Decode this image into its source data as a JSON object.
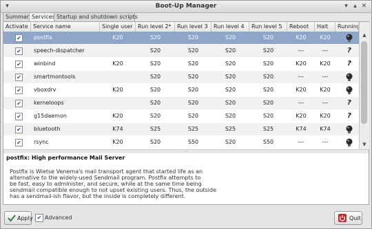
{
  "window": {
    "title": "Boot-Up Manager"
  },
  "tabs": [
    "Summary",
    "Services",
    "Startup and shutdown scripts"
  ],
  "columns": [
    "Activate",
    "Service name",
    "Single user",
    "Run level 2*",
    "Run level 3",
    "Run level 4",
    "Run level 5",
    "Reboot",
    "Halt",
    "Running"
  ],
  "rows": [
    {
      "name": "postfix",
      "single": "K20",
      "rl2": "S20",
      "rl3": "S20",
      "rl4": "S20",
      "rl5": "S20",
      "reboot": "K20",
      "halt": "K20",
      "running": "bulb",
      "selected": true
    },
    {
      "name": "speech-dispatcher",
      "single": "",
      "rl2": "S20",
      "rl3": "S20",
      "rl4": "S20",
      "rl5": "S20",
      "reboot": "---",
      "halt": "---",
      "running": "?"
    },
    {
      "name": "winbind",
      "single": "K20",
      "rl2": "S20",
      "rl3": "S20",
      "rl4": "S20",
      "rl5": "S20",
      "reboot": "K20",
      "halt": "K20",
      "running": "?"
    },
    {
      "name": "smartmontools",
      "single": "",
      "rl2": "S20",
      "rl3": "S20",
      "rl4": "S20",
      "rl5": "S20",
      "reboot": "---",
      "halt": "---",
      "running": "bulb"
    },
    {
      "name": "vboxdrv",
      "single": "K20",
      "rl2": "S20",
      "rl3": "S20",
      "rl4": "S20",
      "rl5": "S20",
      "reboot": "K20",
      "halt": "K20",
      "running": "bulb"
    },
    {
      "name": "kerneloops",
      "single": "",
      "rl2": "S20",
      "rl3": "S20",
      "rl4": "S20",
      "rl5": "S20",
      "reboot": "---",
      "halt": "---",
      "running": "?"
    },
    {
      "name": "g15daemon",
      "single": "K20",
      "rl2": "S20",
      "rl3": "S20",
      "rl4": "S20",
      "rl5": "S20",
      "reboot": "K20",
      "halt": "K20",
      "running": "?"
    },
    {
      "name": "bluetooth",
      "single": "K74",
      "rl2": "S25",
      "rl3": "S25",
      "rl4": "S25",
      "rl5": "S25",
      "reboot": "K74",
      "halt": "K74",
      "running": "bulb"
    },
    {
      "name": "rsync",
      "single": "K20",
      "rl2": "S20",
      "rl3": "S50",
      "rl4": "S20",
      "rl5": "S50",
      "reboot": "---",
      "halt": "---",
      "running": "bulb"
    }
  ],
  "description": {
    "title": "postfix: High performance Mail Server",
    "lines": [
      "Postfix is Wietse Venema's mail transport agent that started life as an",
      "  alternative to the widely-used Sendmail program.  Postfix attempts to",
      "  be fast, easy to administer, and secure, while at the same time being",
      "  sendmail compatible enough to not upset existing users. Thus, the outside",
      "  has a sendmail-ish flavor, but the inside is completely different."
    ]
  },
  "buttons": {
    "apply": "Apply",
    "advanced": "Advanced",
    "quit": "Quit"
  },
  "colors": {
    "selection": "#8da6c9",
    "accent": "#2b4e8c",
    "quit_icon": "#c62828"
  },
  "icons": {
    "activate": "checkbox-checked-icon",
    "running": "lightbulb-icon",
    "unknown": "question-mark-icon"
  }
}
